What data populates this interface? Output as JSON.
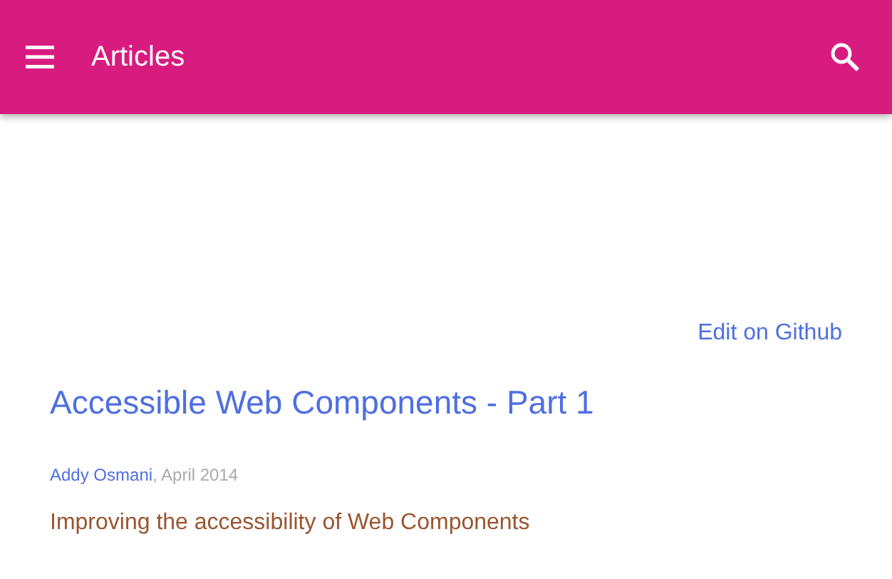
{
  "app_bar": {
    "title": "Articles"
  },
  "edit_link": "Edit on Github",
  "article": {
    "title": "Accessible Web Components - Part 1",
    "author": "Addy Osmani",
    "date": ", April 2014",
    "summary": "Improving the accessibility of Web Components"
  }
}
